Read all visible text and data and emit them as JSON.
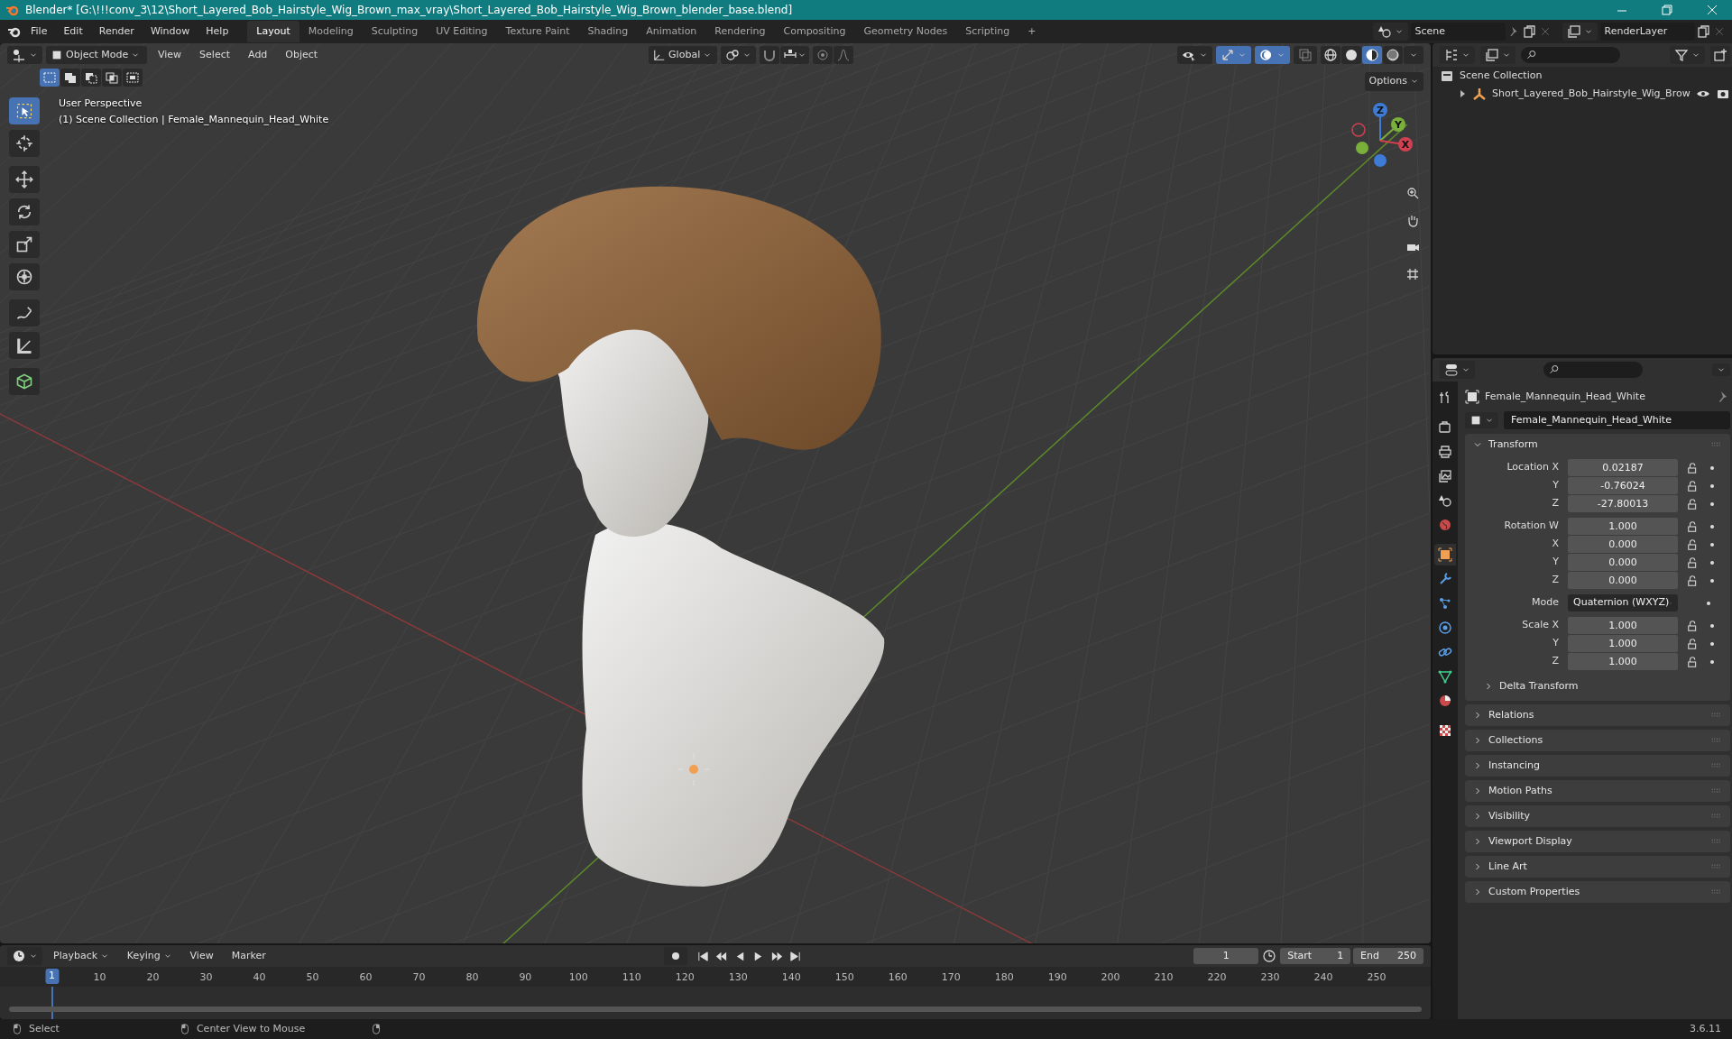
{
  "window": {
    "title": "Blender* [G:\\!!!conv_3\\12\\Short_Layered_Bob_Hairstyle_Wig_Brown_max_vray\\Short_Layered_Bob_Hairstyle_Wig_Brown_blender_base.blend]"
  },
  "menu": [
    "File",
    "Edit",
    "Render",
    "Window",
    "Help"
  ],
  "workspaces": [
    {
      "label": "Layout",
      "selected": true
    },
    {
      "label": "Modeling",
      "selected": false
    },
    {
      "label": "Sculpting",
      "selected": false
    },
    {
      "label": "UV Editing",
      "selected": false
    },
    {
      "label": "Texture Paint",
      "selected": false
    },
    {
      "label": "Shading",
      "selected": false
    },
    {
      "label": "Animation",
      "selected": false
    },
    {
      "label": "Rendering",
      "selected": false
    },
    {
      "label": "Compositing",
      "selected": false
    },
    {
      "label": "Geometry Nodes",
      "selected": false
    },
    {
      "label": "Scripting",
      "selected": false
    }
  ],
  "add_workspace": "+",
  "scene": "Scene",
  "view_layer": "RenderLayer",
  "viewport": {
    "mode": "Object Mode",
    "menus": [
      "View",
      "Select",
      "Add",
      "Object"
    ],
    "orientation": "Global",
    "options": "Options",
    "select_modes": [
      {
        "kind": "set",
        "selected": true
      },
      {
        "kind": "extend",
        "selected": false
      },
      {
        "kind": "subtract",
        "selected": false
      },
      {
        "kind": "invert",
        "selected": false
      },
      {
        "kind": "intersect",
        "selected": false
      }
    ],
    "toggles": [
      {
        "kind": "visibility",
        "on": false
      },
      {
        "kind": "gizmos",
        "on": true
      },
      {
        "kind": "overlays",
        "on": true
      },
      {
        "kind": "xray",
        "on": false
      }
    ],
    "shading": [
      {
        "kind": "wireframe",
        "selected": false
      },
      {
        "kind": "solid",
        "selected": false
      },
      {
        "kind": "material",
        "selected": true
      },
      {
        "kind": "rendered",
        "selected": false
      }
    ],
    "view_name": "User Perspective",
    "info": "(1) Scene Collection | Female_Mannequin_Head_White",
    "tools": [
      {
        "kind": "select",
        "selected": true
      },
      {
        "kind": "cursor",
        "selected": false
      },
      {
        "kind": "move",
        "selected": false
      },
      {
        "kind": "rotate",
        "selected": false
      },
      {
        "kind": "scale",
        "selected": false
      },
      {
        "kind": "transform",
        "selected": false
      },
      {
        "kind": "annotate",
        "selected": false
      },
      {
        "kind": "measure",
        "selected": false
      },
      {
        "kind": "add-cube",
        "selected": false
      }
    ],
    "axes": [
      "Z",
      "Y",
      "X"
    ]
  },
  "outliner": {
    "root": "Scene Collection",
    "children": [
      {
        "label": "Short_Layered_Bob_Hairstyle_Wig_Brow",
        "expanded": false
      }
    ]
  },
  "properties": {
    "tabs": [
      {
        "kind": "tool",
        "selected": false
      },
      {
        "kind": "render",
        "selected": false
      },
      {
        "kind": "output",
        "selected": false
      },
      {
        "kind": "view-layer",
        "selected": false
      },
      {
        "kind": "scene",
        "selected": false
      },
      {
        "kind": "world",
        "selected": false
      },
      {
        "kind": "object",
        "selected": true
      },
      {
        "kind": "modifiers",
        "selected": false
      },
      {
        "kind": "particles",
        "selected": false
      },
      {
        "kind": "physics",
        "selected": false
      },
      {
        "kind": "constraints",
        "selected": false
      },
      {
        "kind": "data",
        "selected": false
      },
      {
        "kind": "material",
        "selected": false
      },
      {
        "kind": "texture",
        "selected": false
      }
    ],
    "object_name": "Female_Mannequin_Head_White",
    "data_name": "Female_Mannequin_Head_White",
    "panels": [
      {
        "title": "Transform",
        "expanded": true,
        "groups": [
          [
            {
              "label": "Location X",
              "value": "0.02187",
              "kind": "number"
            },
            {
              "label": "Y",
              "value": "-0.76024",
              "kind": "number"
            },
            {
              "label": "Z",
              "value": "-27.80013",
              "kind": "number"
            }
          ],
          [
            {
              "label": "Rotation W",
              "value": "1.000",
              "kind": "number"
            },
            {
              "label": "X",
              "value": "0.000",
              "kind": "number"
            },
            {
              "label": "Y",
              "value": "0.000",
              "kind": "number"
            },
            {
              "label": "Z",
              "value": "0.000",
              "kind": "number"
            }
          ],
          [
            {
              "label": "Mode",
              "value": "Quaternion (WXYZ)",
              "kind": "dropdown"
            }
          ],
          [
            {
              "label": "Scale X",
              "value": "1.000",
              "kind": "number"
            },
            {
              "label": "Y",
              "value": "1.000",
              "kind": "number"
            },
            {
              "label": "Z",
              "value": "1.000",
              "kind": "number"
            }
          ]
        ],
        "subpanels": [
          {
            "title": "Delta Transform",
            "expanded": false
          }
        ]
      },
      {
        "title": "Relations",
        "expanded": false
      },
      {
        "title": "Collections",
        "expanded": false
      },
      {
        "title": "Instancing",
        "expanded": false
      },
      {
        "title": "Motion Paths",
        "expanded": false
      },
      {
        "title": "Visibility",
        "expanded": false
      },
      {
        "title": "Viewport Display",
        "expanded": false
      },
      {
        "title": "Line Art",
        "expanded": false
      },
      {
        "title": "Custom Properties",
        "expanded": false
      }
    ]
  },
  "timeline": {
    "menus": [
      {
        "label": "Playback",
        "dropdown": true
      },
      {
        "label": "Keying",
        "dropdown": true
      },
      {
        "label": "View",
        "dropdown": false
      },
      {
        "label": "Marker",
        "dropdown": false
      }
    ],
    "current_frame": "1",
    "start_label": "Start",
    "start": "1",
    "end_label": "End",
    "end": "250",
    "playhead": "1",
    "ticks": [
      "10",
      "20",
      "30",
      "40",
      "50",
      "60",
      "70",
      "80",
      "90",
      "100",
      "110",
      "120",
      "130",
      "140",
      "150",
      "160",
      "170",
      "180",
      "190",
      "200",
      "210",
      "220",
      "230",
      "240",
      "250"
    ]
  },
  "status_bar": {
    "items": [
      "Select",
      "Center View to Mouse"
    ],
    "version": "3.6.11"
  }
}
